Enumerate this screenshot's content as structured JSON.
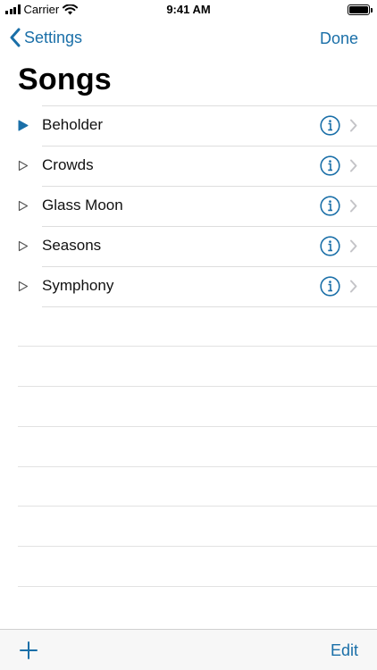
{
  "status_bar": {
    "carrier": "Carrier",
    "time": "9:41 AM"
  },
  "nav": {
    "back_label": "Settings",
    "done_label": "Done"
  },
  "page": {
    "title": "Songs"
  },
  "songs": [
    {
      "title": "Beholder",
      "playing": true
    },
    {
      "title": "Crowds",
      "playing": false
    },
    {
      "title": "Glass Moon",
      "playing": false
    },
    {
      "title": "Seasons",
      "playing": false
    },
    {
      "title": "Symphony",
      "playing": false
    }
  ],
  "toolbar": {
    "edit_label": "Edit"
  },
  "icons": {
    "back": "chevron-left-icon",
    "play": "play-icon",
    "info": "info-icon",
    "disclosure": "chevron-right-icon",
    "add": "plus-icon",
    "wifi": "wifi-icon",
    "signal": "signal-icon",
    "battery": "battery-icon"
  },
  "colors": {
    "accent": "#1a6fa8",
    "separator": "#dedede",
    "toolbar_bg": "#f7f7f7"
  }
}
